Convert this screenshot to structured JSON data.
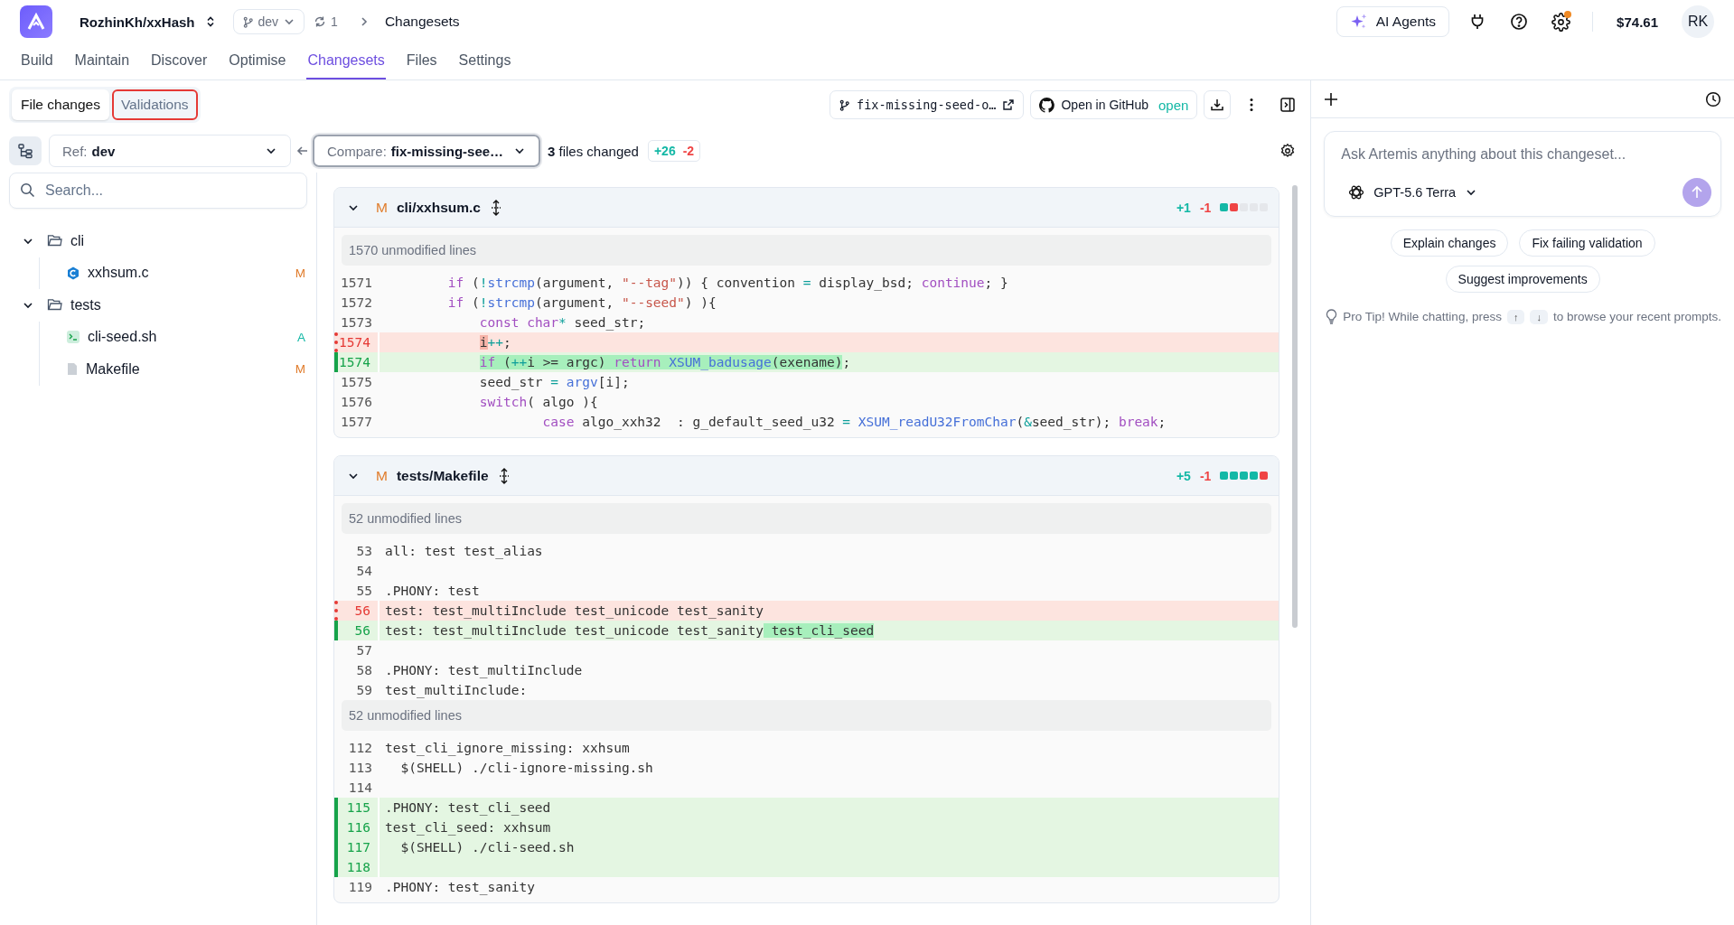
{
  "header": {
    "repo": "RozhinKh/xxHash",
    "branch": "dev",
    "sync_count": "1",
    "breadcrumb": "Changesets",
    "ai_button": "AI Agents",
    "settings_badge": true,
    "balance": "$74.61",
    "avatar": "RK"
  },
  "nav_tabs": [
    {
      "label": "Build",
      "selected": false
    },
    {
      "label": "Maintain",
      "selected": false
    },
    {
      "label": "Discover",
      "selected": false
    },
    {
      "label": "Optimise",
      "selected": false
    },
    {
      "label": "Changesets",
      "selected": true
    },
    {
      "label": "Files",
      "selected": false
    },
    {
      "label": "Settings",
      "selected": false
    }
  ],
  "view_tabs": [
    {
      "label": "File changes",
      "selected": true,
      "outlined": false
    },
    {
      "label": "Validations",
      "selected": false,
      "outlined": true
    }
  ],
  "toolbar": {
    "branch_chip": "fix-missing-seed-o…",
    "github_button": "Open in GitHub",
    "github_status": "open"
  },
  "compare": {
    "ref_label": "Ref:",
    "ref_value": "dev",
    "compare_label": "Compare:",
    "compare_value": "fix-missing-see…",
    "files_count": "3",
    "files_text": "files changed",
    "additions": "+26",
    "deletions": "-2"
  },
  "search": {
    "placeholder": "Search..."
  },
  "file_tree": [
    {
      "name": "cli",
      "kind": "folder",
      "expanded": true,
      "children": [
        {
          "name": "xxhsum.c",
          "kind": "c-file",
          "status": "M",
          "color": "#e07b2a"
        }
      ]
    },
    {
      "name": "tests",
      "kind": "folder",
      "expanded": true,
      "children": [
        {
          "name": "cli-seed.sh",
          "kind": "shell-file",
          "status": "A",
          "color": "#14b8a6"
        },
        {
          "name": "Makefile",
          "kind": "file",
          "status": "M",
          "color": "#e07b2a"
        }
      ]
    }
  ],
  "diffs": [
    {
      "status": "M",
      "path": "cli/xxhsum.c",
      "kind": "c-code",
      "expanded": true,
      "additions": "+1",
      "deletions": "-1",
      "bar": [
        {
          "kind": "added"
        },
        {
          "kind": "removed"
        },
        {
          "kind": "unchanged"
        },
        {
          "kind": "unchanged"
        },
        {
          "kind": "unchanged"
        }
      ],
      "rows": [
        {
          "kind": "collapsed",
          "text": "1570 unmodified lines"
        },
        {
          "kind": "context",
          "num": "1571",
          "code": "        if (!strcmp(argument, \"--tag\")) { convention = display_bsd; continue; }"
        },
        {
          "kind": "context",
          "num": "1572",
          "code": "        if (!strcmp(argument, \"--seed\") ){"
        },
        {
          "kind": "context",
          "num": "1573",
          "code": "            const char* seed_str;"
        },
        {
          "kind": "removed",
          "num": "1574",
          "parts": [
            {
              "text": "            i",
              "changed": true
            },
            {
              "text": "++;",
              "changed": false
            }
          ]
        },
        {
          "kind": "added",
          "num": "1574",
          "parts": [
            {
              "text": "            if (++i >= argc) return XSUM_badusage(exename)",
              "changed": true
            },
            {
              "text": ";",
              "changed": false
            }
          ]
        },
        {
          "kind": "context",
          "num": "1575",
          "code": "            seed_str = argv[i];"
        },
        {
          "kind": "context",
          "num": "1576",
          "code": "            switch( algo ){"
        },
        {
          "kind": "context",
          "num": "1577",
          "code": "                    case algo_xxh32  : g_default_seed_u32 = XSUM_readU32FromChar(&seed_str); break;"
        }
      ]
    },
    {
      "status": "M",
      "path": "tests/Makefile",
      "kind": "plain-text",
      "expanded": true,
      "additions": "+5",
      "deletions": "-1",
      "bar": [
        {
          "kind": "added"
        },
        {
          "kind": "added"
        },
        {
          "kind": "added"
        },
        {
          "kind": "added"
        },
        {
          "kind": "removed"
        }
      ],
      "rows": [
        {
          "kind": "collapsed",
          "text": "52 unmodified lines"
        },
        {
          "kind": "context",
          "num": "53",
          "code": "all: test test_alias"
        },
        {
          "kind": "context",
          "num": "54"
        },
        {
          "kind": "context",
          "num": "55",
          "code": ".PHONY: test"
        },
        {
          "kind": "removed",
          "num": "56",
          "code": "test: test_multiInclude test_unicode test_sanity"
        },
        {
          "kind": "added",
          "num": "56",
          "parts": [
            {
              "text": "test: test_multiInclude test_unicode test_sanity",
              "changed": false
            },
            {
              "text": " test_cli_seed",
              "changed": true
            }
          ]
        },
        {
          "kind": "context",
          "num": "57"
        },
        {
          "kind": "context",
          "num": "58",
          "code": ".PHONY: test_multiInclude"
        },
        {
          "kind": "context",
          "num": "59",
          "code": "test_multiInclude:"
        },
        {
          "kind": "collapsed",
          "text": "52 unmodified lines"
        },
        {
          "kind": "context",
          "num": "112",
          "code": "test_cli_ignore_missing: xxhsum"
        },
        {
          "kind": "context",
          "num": "113",
          "code": "  $(SHELL) ./cli-ignore-missing.sh"
        },
        {
          "kind": "context",
          "num": "114"
        },
        {
          "kind": "added",
          "num": "115",
          "code": ".PHONY: test_cli_seed"
        },
        {
          "kind": "added",
          "num": "116",
          "code": "test_cli_seed: xxhsum"
        },
        {
          "kind": "added",
          "num": "117",
          "code": "  $(SHELL) ./cli-seed.sh"
        },
        {
          "kind": "added",
          "num": "118"
        },
        {
          "kind": "context",
          "num": "119",
          "code": ".PHONY: test_sanity"
        }
      ]
    }
  ],
  "chat": {
    "placeholder": "Ask Artemis anything about this changeset...",
    "model": "GPT-5.6 Terra",
    "suggestions": [
      "Explain changes",
      "Fix failing validation",
      "Suggest improvements"
    ],
    "tip_before": "Pro Tip! While chatting, press",
    "keys": [
      "↑",
      "↓"
    ],
    "tip_after": "to browse your recent prompts."
  }
}
